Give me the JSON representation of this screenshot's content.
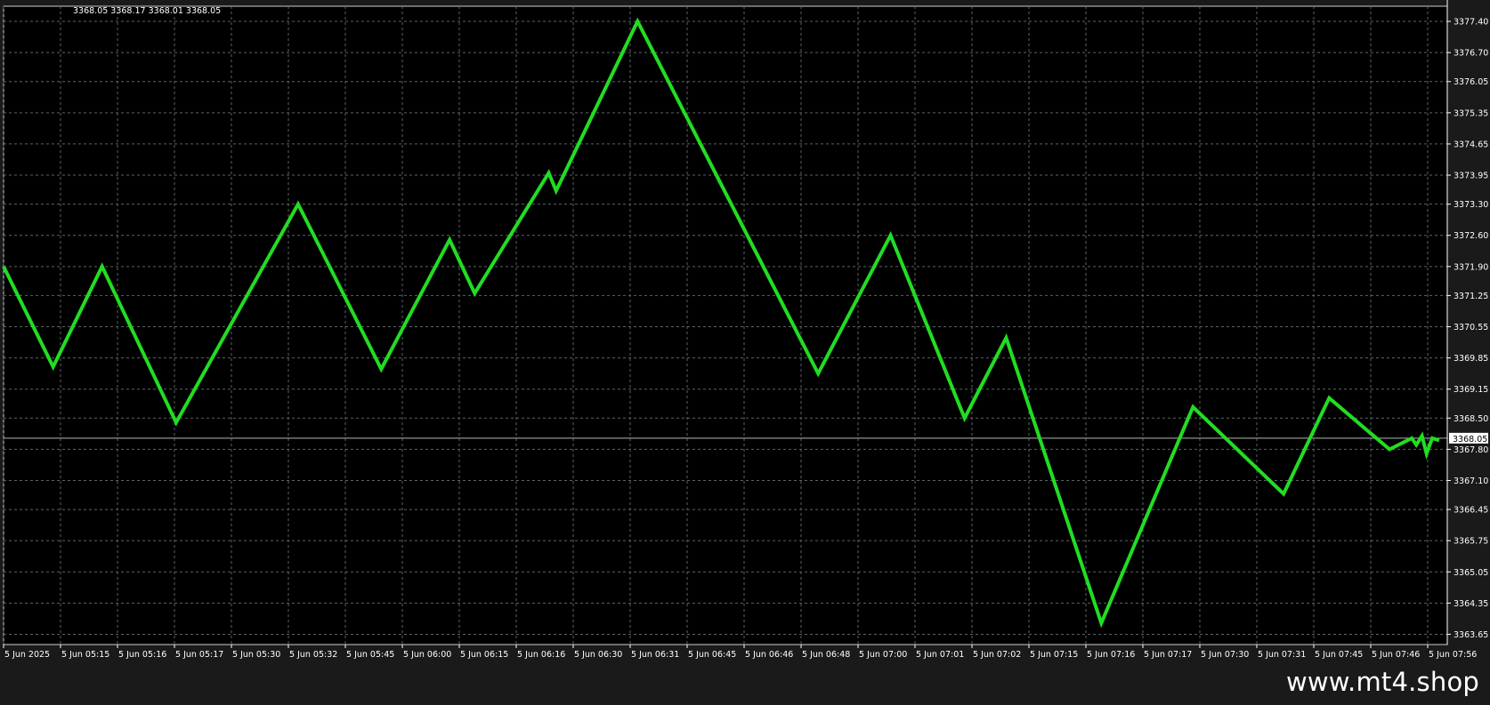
{
  "header": {
    "ohlc": "3368.05 3368.17 3368.01 3368.05"
  },
  "footer": {
    "watermark": "www.mt4.shop"
  },
  "colors": {
    "background": "#000000",
    "frame": "#1a1a1a",
    "grid": "#5a6466",
    "line": "#22dd22",
    "axis_text": "#ffffff",
    "current_price_line": "#b4b4b4"
  },
  "chart_data": {
    "type": "line",
    "title": "",
    "xlabel": "",
    "ylabel": "",
    "ylim": [
      3363.42,
      3377.74
    ],
    "grid": true,
    "x_tick_labels": [
      "5 Jun 2025",
      "5 Jun 05:15",
      "5 Jun 05:16",
      "5 Jun 05:17",
      "5 Jun 05:30",
      "5 Jun 05:32",
      "5 Jun 05:45",
      "5 Jun 06:00",
      "5 Jun 06:15",
      "5 Jun 06:16",
      "5 Jun 06:30",
      "5 Jun 06:31",
      "5 Jun 06:45",
      "5 Jun 06:46",
      "5 Jun 06:48",
      "5 Jun 07:00",
      "5 Jun 07:01",
      "5 Jun 07:02",
      "5 Jun 07:15",
      "5 Jun 07:16",
      "5 Jun 07:17",
      "5 Jun 07:30",
      "5 Jun 07:31",
      "5 Jun 07:45",
      "5 Jun 07:46",
      "5 Jun 07:56"
    ],
    "y_tick_values": [
      3377.4,
      3376.7,
      3376.05,
      3375.35,
      3374.65,
      3373.95,
      3373.3,
      3372.6,
      3371.9,
      3371.25,
      3370.55,
      3369.85,
      3369.15,
      3368.5,
      3367.8,
      3367.1,
      3366.45,
      3365.75,
      3365.05,
      3364.35,
      3363.65
    ],
    "y_tick_labels": [
      "3377.40",
      "3376.70",
      "3376.05",
      "3375.35",
      "3374.65",
      "3373.95",
      "3373.30",
      "3372.60",
      "3371.90",
      "3371.25",
      "3370.55",
      "3369.85",
      "3369.15",
      "3368.50",
      "3367.80",
      "3367.10",
      "3366.45",
      "3365.75",
      "3365.05",
      "3364.35",
      "3363.65"
    ],
    "current_price": {
      "value": 3368.05,
      "label": "3368.05"
    },
    "series": [
      {
        "x": [
          0,
          0.87,
          1.73,
          3.03,
          5.17,
          6.63,
          7.83,
          8.27,
          9.57,
          9.7,
          11.13,
          14.3,
          15.57,
          16.87,
          17.6,
          19.27,
          20.88,
          22.47,
          23.27,
          24.33,
          24.72,
          24.8,
          24.9,
          24.98,
          25.08,
          25.2
        ],
        "y": [
          3371.9,
          3369.65,
          3371.9,
          3368.4,
          3373.3,
          3369.6,
          3372.5,
          3371.3,
          3374.0,
          3373.6,
          3377.4,
          3369.5,
          3372.6,
          3368.5,
          3370.3,
          3363.9,
          3368.75,
          3366.8,
          3368.95,
          3367.8,
          3368.05,
          3367.9,
          3368.1,
          3367.7,
          3368.05,
          3368.0
        ]
      }
    ]
  }
}
